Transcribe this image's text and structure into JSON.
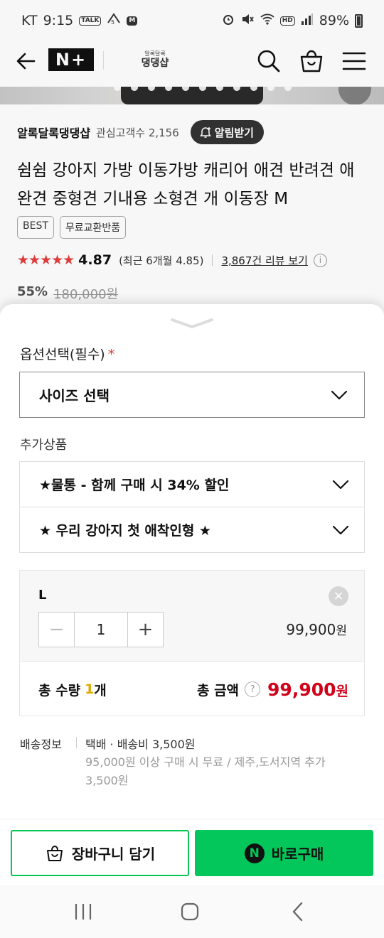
{
  "status_bar": {
    "carrier": "KT",
    "time": "9:15",
    "badge_talk": "TALK",
    "badge_m": "M",
    "hd": "HD",
    "battery": "89%"
  },
  "header": {
    "n_plus": "N+",
    "brand_logo_small": "알록달록",
    "brand_logo_big": "댕댕샵"
  },
  "product": {
    "store_name": "알록달록댕댕샵",
    "fans_label": "관심고객수 2,156",
    "alarm_button": "알림받기",
    "title": "쉼쉼 강아지 가방 이동가방 캐리어 애견 반려견 애완견 중형견 기내용 소형견 개 이동장 M",
    "badges": [
      "BEST",
      "무료교환반품"
    ],
    "stars": "★★★★★",
    "rating": "4.87",
    "recent_rating": "(최근 6개월 4.85)",
    "review_link": "3,867건 리뷰 보기",
    "info_icon": "i",
    "discount": "55%",
    "original_price": "180,000원"
  },
  "sheet": {
    "option_label": "옵션선택(필수)",
    "required_mark": "*",
    "size_select": "사이즈 선택",
    "addon_label": "추가상품",
    "addons": [
      "★물통 - 함께 구매 시 34% 할인",
      "★ 우리 강아지 첫 애착인형 ★"
    ],
    "item": {
      "name": "L",
      "remove": "×",
      "minus": "−",
      "qty": "1",
      "plus": "+",
      "price": "99,900",
      "won": "원"
    },
    "total": {
      "qty_label": "총 수량",
      "qty_value": "1",
      "qty_unit": "개",
      "amount_label": "총 금액",
      "help": "?",
      "amount": "99,900",
      "won": "원"
    },
    "shipping": {
      "label": "배송정보",
      "main": "택배 · 배송비 3,500원",
      "sub": "95,000원 이상 구매 시 무료 / 제주,도서지역 추가 3,500원"
    }
  },
  "actions": {
    "cart": "장바구니 담기",
    "buy_badge": "N",
    "buy": "바로구매"
  },
  "colors": {
    "accent_green": "#03c75a",
    "price_red": "#d0021b",
    "star_red": "#e43e3e"
  }
}
